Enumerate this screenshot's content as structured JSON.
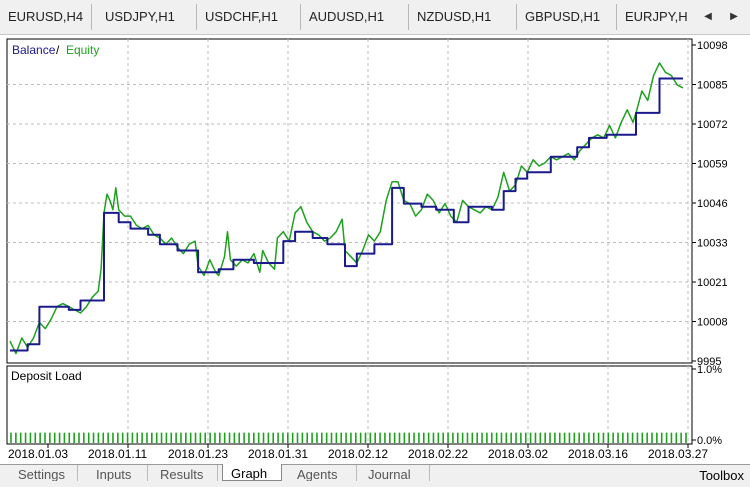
{
  "symbol_tabs": [
    "EURUSD,H4",
    "USDJPY,H1",
    "USDCHF,H1",
    "AUDUSD,H1",
    "NZDUSD,H1",
    "GBPUSD,H1",
    "EURJPY,H"
  ],
  "nav": {
    "left_icon": "arrow-left-icon",
    "right_icon": "arrow-right-icon",
    "left": "◀",
    "right": "▶"
  },
  "colors": {
    "balance": "#1a1a8c",
    "equity": "#1fa01f",
    "load": "#1fa01f",
    "grid": "#bdbdbd"
  },
  "main_chart": {
    "legend_balance": "Balance",
    "legend_sep": "/",
    "legend_equity": "Equity",
    "y_ticks": [
      "10098",
      "10085",
      "10072",
      "10059",
      "10046",
      "10033",
      "10021",
      "10008",
      "9995"
    ]
  },
  "sub_chart": {
    "title": "Deposit Load",
    "y_ticks": [
      "1.0%",
      "0.0%"
    ]
  },
  "x_ticks": [
    "2018.01.03",
    "2018.01.11",
    "2018.01.23",
    "2018.01.31",
    "2018.02.12",
    "2018.02.22",
    "2018.03.02",
    "2018.03.16",
    "2018.03.27"
  ],
  "bottom_tabs": [
    "Settings",
    "Inputs",
    "Results",
    "Graph",
    "Agents",
    "Journal"
  ],
  "active_tab": "Graph",
  "toolbox": "Toolbox",
  "chart_data": [
    {
      "type": "line",
      "title": "",
      "legend": [
        "Balance",
        "Equity"
      ],
      "ylim": [
        9995,
        10098
      ],
      "x_labels": [
        "2018.01.03",
        "2018.01.11",
        "2018.01.23",
        "2018.01.31",
        "2018.02.12",
        "2018.02.22",
        "2018.03.02",
        "2018.03.16",
        "2018.03.27"
      ],
      "series": [
        {
          "name": "Balance",
          "points": [
            [
              0,
              9999
            ],
            [
              6,
              9999
            ],
            [
              6,
              10001
            ],
            [
              10,
              10001
            ],
            [
              10,
              10013
            ],
            [
              20,
              10013
            ],
            [
              20,
              10012
            ],
            [
              24,
              10012
            ],
            [
              24,
              10015
            ],
            [
              32,
              10015
            ],
            [
              32,
              10043
            ],
            [
              37,
              10043
            ],
            [
              37,
              10040
            ],
            [
              41,
              10040
            ],
            [
              41,
              10038
            ],
            [
              47,
              10038
            ],
            [
              47,
              10036
            ],
            [
              51,
              10036
            ],
            [
              51,
              10033
            ],
            [
              57,
              10033
            ],
            [
              57,
              10031
            ],
            [
              64,
              10031
            ],
            [
              64,
              10024
            ],
            [
              71,
              10024
            ],
            [
              71,
              10025
            ],
            [
              76,
              10025
            ],
            [
              76,
              10028
            ],
            [
              83,
              10028
            ],
            [
              83,
              10027
            ],
            [
              88,
              10027
            ],
            [
              88,
              10027
            ],
            [
              93,
              10027
            ],
            [
              93,
              10034
            ],
            [
              97,
              10034
            ],
            [
              97,
              10037
            ],
            [
              103,
              10037
            ],
            [
              103,
              10035
            ],
            [
              108,
              10035
            ],
            [
              108,
              10033
            ],
            [
              114,
              10033
            ],
            [
              114,
              10026
            ],
            [
              118,
              10026
            ],
            [
              118,
              10030
            ],
            [
              124,
              10030
            ],
            [
              124,
              10033
            ],
            [
              130,
              10033
            ],
            [
              130,
              10051
            ],
            [
              134,
              10051
            ],
            [
              134,
              10046
            ],
            [
              140,
              10046
            ],
            [
              140,
              10045
            ],
            [
              145,
              10045
            ],
            [
              145,
              10044
            ],
            [
              151,
              10044
            ],
            [
              151,
              10040
            ],
            [
              156,
              10040
            ],
            [
              156,
              10045
            ],
            [
              164,
              10045
            ],
            [
              164,
              10044
            ],
            [
              168,
              10044
            ],
            [
              168,
              10050
            ],
            [
              172,
              10050
            ],
            [
              172,
              10054
            ],
            [
              176,
              10054
            ],
            [
              176,
              10056
            ],
            [
              184,
              10056
            ],
            [
              184,
              10061
            ],
            [
              193,
              10061
            ],
            [
              193,
              10064
            ],
            [
              197,
              10064
            ],
            [
              197,
              10067
            ],
            [
              203,
              10067
            ],
            [
              203,
              10068
            ],
            [
              213,
              10068
            ],
            [
              213,
              10075
            ],
            [
              221,
              10075
            ],
            [
              221,
              10086
            ],
            [
              226,
              10086
            ],
            [
              226,
              10086
            ],
            [
              229,
              10086
            ]
          ]
        },
        {
          "name": "Equity",
          "points": [
            [
              0,
              10002
            ],
            [
              2,
              9998
            ],
            [
              4,
              10003
            ],
            [
              6,
              10000
            ],
            [
              8,
              10003
            ],
            [
              10,
              10008
            ],
            [
              12,
              10006
            ],
            [
              14,
              10009
            ],
            [
              16,
              10013
            ],
            [
              18,
              10014
            ],
            [
              20,
              10013
            ],
            [
              22,
              10012
            ],
            [
              24,
              10011
            ],
            [
              26,
              10013
            ],
            [
              28,
              10016
            ],
            [
              30,
              10018
            ],
            [
              31,
              10025
            ],
            [
              32,
              10043
            ],
            [
              33,
              10049
            ],
            [
              34,
              10047
            ],
            [
              35,
              10044
            ],
            [
              36,
              10051
            ],
            [
              37,
              10044
            ],
            [
              39,
              10042
            ],
            [
              41,
              10042
            ],
            [
              43,
              10039
            ],
            [
              45,
              10038
            ],
            [
              47,
              10039
            ],
            [
              49,
              10036
            ],
            [
              51,
              10035
            ],
            [
              53,
              10033
            ],
            [
              55,
              10035
            ],
            [
              57,
              10032
            ],
            [
              59,
              10030
            ],
            [
              61,
              10033
            ],
            [
              63,
              10034
            ],
            [
              64,
              10026
            ],
            [
              66,
              10023
            ],
            [
              68,
              10028
            ],
            [
              70,
              10024
            ],
            [
              71,
              10023
            ],
            [
              73,
              10029
            ],
            [
              74,
              10037
            ],
            [
              75,
              10028
            ],
            [
              77,
              10026
            ],
            [
              79,
              10028
            ],
            [
              81,
              10027
            ],
            [
              83,
              10030
            ],
            [
              85,
              10024
            ],
            [
              86,
              10031
            ],
            [
              88,
              10027
            ],
            [
              90,
              10025
            ],
            [
              91,
              10035
            ],
            [
              93,
              10037
            ],
            [
              95,
              10034
            ],
            [
              97,
              10043
            ],
            [
              99,
              10045
            ],
            [
              101,
              10040
            ],
            [
              103,
              10037
            ],
            [
              105,
              10036
            ],
            [
              107,
              10034
            ],
            [
              109,
              10035
            ],
            [
              111,
              10037
            ],
            [
              113,
              10041
            ],
            [
              114,
              10031
            ],
            [
              116,
              10029
            ],
            [
              118,
              10027
            ],
            [
              120,
              10031
            ],
            [
              122,
              10036
            ],
            [
              124,
              10034
            ],
            [
              126,
              10037
            ],
            [
              128,
              10047
            ],
            [
              130,
              10053
            ],
            [
              132,
              10053
            ],
            [
              134,
              10047
            ],
            [
              136,
              10046
            ],
            [
              138,
              10042
            ],
            [
              140,
              10044
            ],
            [
              142,
              10049
            ],
            [
              144,
              10047
            ],
            [
              146,
              10043
            ],
            [
              148,
              10046
            ],
            [
              150,
              10042
            ],
            [
              152,
              10040
            ],
            [
              154,
              10047
            ],
            [
              156,
              10045
            ],
            [
              158,
              10044
            ],
            [
              160,
              10043
            ],
            [
              162,
              10045
            ],
            [
              164,
              10044
            ],
            [
              166,
              10048
            ],
            [
              168,
              10056
            ],
            [
              170,
              10050
            ],
            [
              172,
              10052
            ],
            [
              174,
              10058
            ],
            [
              176,
              10056
            ],
            [
              178,
              10060
            ],
            [
              180,
              10058
            ],
            [
              182,
              10059
            ],
            [
              184,
              10061
            ],
            [
              186,
              10060
            ],
            [
              188,
              10061
            ],
            [
              190,
              10062
            ],
            [
              192,
              10060
            ],
            [
              194,
              10063
            ],
            [
              196,
              10065
            ],
            [
              198,
              10067
            ],
            [
              200,
              10068
            ],
            [
              202,
              10067
            ],
            [
              204,
              10071
            ],
            [
              206,
              10067
            ],
            [
              208,
              10072
            ],
            [
              210,
              10076
            ],
            [
              212,
              10072
            ],
            [
              213,
              10075
            ],
            [
              215,
              10082
            ],
            [
              217,
              10079
            ],
            [
              219,
              10087
            ],
            [
              221,
              10091
            ],
            [
              223,
              10088
            ],
            [
              225,
              10087
            ],
            [
              227,
              10084
            ],
            [
              229,
              10083
            ]
          ]
        }
      ]
    },
    {
      "type": "bar",
      "title": "Deposit Load",
      "ylim": [
        0,
        1.0
      ],
      "note": "dense series of small bars near 0.0%",
      "bar_count": 140,
      "value": 0.14
    }
  ]
}
